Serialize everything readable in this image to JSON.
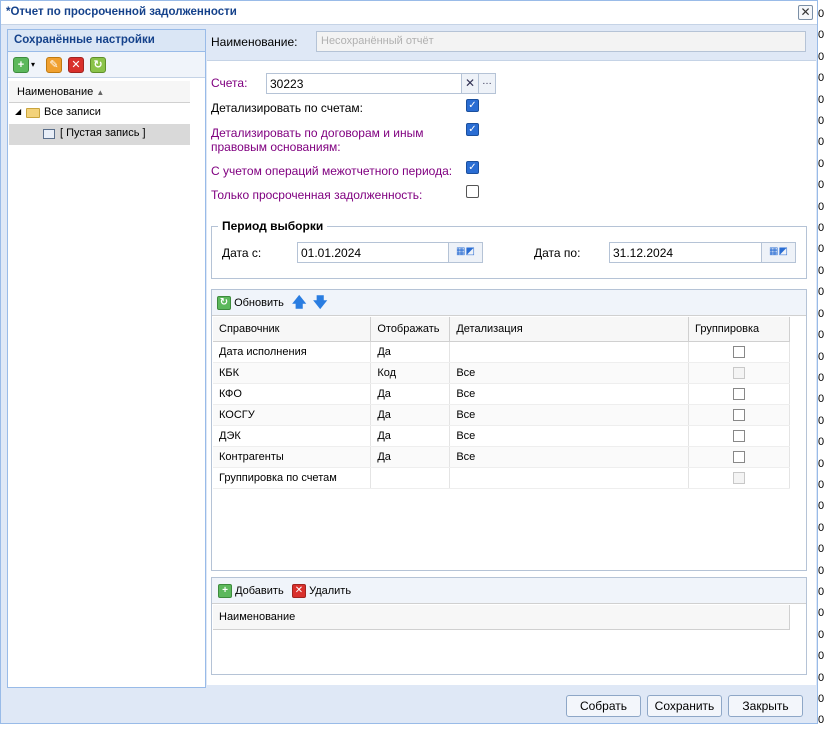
{
  "window": {
    "title": "*Отчет по просроченной задолженности"
  },
  "left_panel": {
    "header": "Сохранённые настройки",
    "column_header": "Наименование",
    "tree": [
      {
        "label": "Все записи"
      },
      {
        "label": "[ Пустая запись ]"
      }
    ]
  },
  "form": {
    "name_label": "Наименование:",
    "name_placeholder": "Несохранённый отчёт",
    "accounts_label": "Счета:",
    "accounts_value": "30223",
    "options": [
      {
        "label": "Детализировать по счетам:",
        "checked": true
      },
      {
        "label_line1": "Детализировать по договорам и иным",
        "label_line2": "правовым основаниям:",
        "checked": true
      },
      {
        "label": "С учетом операций межотчетного периода:",
        "checked": true
      },
      {
        "label": "Только просроченная задолженность:",
        "checked": false
      }
    ],
    "period": {
      "legend": "Период выборки",
      "from_label": "Дата с:",
      "from_value": "01.01.2024",
      "to_label": "Дата по:",
      "to_value": "31.12.2024"
    }
  },
  "ref_grid": {
    "refresh_label": "Обновить",
    "columns": [
      "Справочник",
      "Отображать",
      "Детализация",
      "Группировка"
    ],
    "rows": [
      {
        "ref": "Дата исполнения",
        "show": "Да",
        "detail": "",
        "group_enabled": true
      },
      {
        "ref": "КБК",
        "show": "Код",
        "detail": "Все",
        "group_enabled": false
      },
      {
        "ref": "КФО",
        "show": "Да",
        "detail": "Все",
        "group_enabled": true
      },
      {
        "ref": "КОСГУ",
        "show": "Да",
        "detail": "Все",
        "group_enabled": true
      },
      {
        "ref": "ДЭК",
        "show": "Да",
        "detail": "Все",
        "group_enabled": true
      },
      {
        "ref": "Контрагенты",
        "show": "Да",
        "detail": "Все",
        "group_enabled": true
      },
      {
        "ref": "Группировка по счетам",
        "show": "",
        "detail": "",
        "group_enabled": false
      }
    ]
  },
  "list_grid": {
    "add_label": "Добавить",
    "delete_label": "Удалить",
    "column": "Наименование"
  },
  "footer": {
    "collect": "Собрать",
    "save": "Сохранить",
    "close": "Закрыть"
  },
  "edge_digits": [
    "0",
    "0",
    "0",
    "0",
    "0",
    "0",
    "0",
    "0",
    "0",
    "0",
    "0",
    "0",
    "0",
    "0",
    "0",
    "0",
    "0",
    "0",
    "0",
    "0",
    "0",
    "0",
    "0",
    "0",
    "0",
    "0",
    "0",
    "0",
    "0",
    "0",
    "0",
    "0",
    "0",
    "0"
  ],
  "colors": {
    "accent": "#15428b",
    "purple_label": "#800080",
    "checkbox_on": "#2a6dd3"
  }
}
